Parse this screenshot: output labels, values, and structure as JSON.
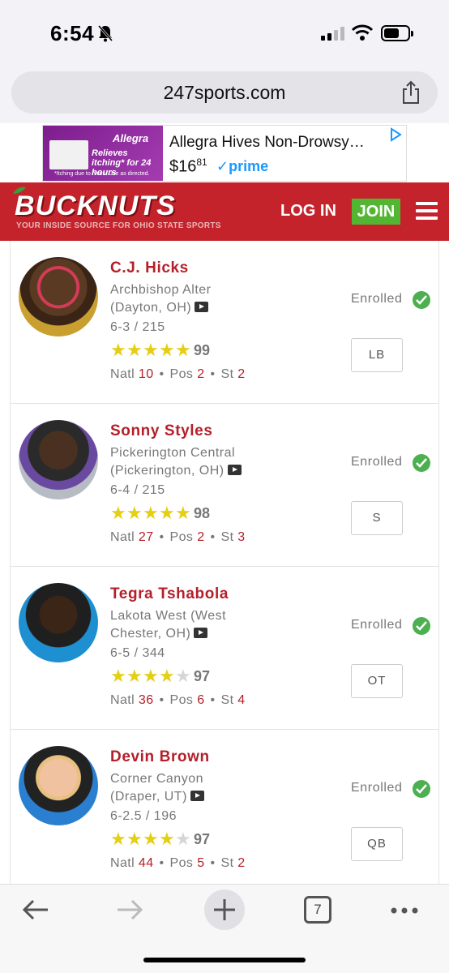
{
  "status_bar": {
    "time": "6:54"
  },
  "browser": {
    "url": "247sports.com"
  },
  "ad": {
    "brand": "Allegra",
    "claim": "Relieves itching* for 24 hours",
    "fine_print": "*Itching due to hives. Use as directed.",
    "title": "Allegra Hives Non-Drowsy…",
    "price_dollars": "$16",
    "price_cents": "81",
    "prime": "✓prime"
  },
  "site": {
    "logo": "BUCKNUTS",
    "tagline": "YOUR INSIDE SOURCE FOR OHIO STATE SPORTS",
    "login": "LOG IN",
    "join": "JOIN",
    "colors": {
      "header": "#c5232b",
      "join": "#53b632",
      "accent": "#b4202a"
    }
  },
  "players": [
    {
      "name": "C.J. Hicks",
      "school_line1": "Archbishop Alter",
      "school_line2": "(Dayton, OH)",
      "measurables": "6-3 / 215",
      "stars": 5,
      "rating": "99",
      "natl": "10",
      "pos_rank": "2",
      "st_rank": "2",
      "status": "Enrolled",
      "position": "LB"
    },
    {
      "name": "Sonny Styles",
      "school_line1": "Pickerington Central",
      "school_line2": "(Pickerington, OH)",
      "measurables": "6-4 / 215",
      "stars": 5,
      "rating": "98",
      "natl": "27",
      "pos_rank": "2",
      "st_rank": "3",
      "status": "Enrolled",
      "position": "S"
    },
    {
      "name": "Tegra Tshabola",
      "school_line1": "Lakota West (West",
      "school_line2": "Chester, OH)",
      "measurables": "6-5 / 344",
      "stars": 4,
      "rating": "97",
      "natl": "36",
      "pos_rank": "6",
      "st_rank": "4",
      "status": "Enrolled",
      "position": "OT"
    },
    {
      "name": "Devin Brown",
      "school_line1": "Corner Canyon",
      "school_line2": "(Draper, UT)",
      "measurables": "6-2.5 / 196",
      "stars": 4,
      "rating": "97",
      "natl": "44",
      "pos_rank": "5",
      "st_rank": "2",
      "status": "Enrolled",
      "position": "QB"
    }
  ],
  "labels": {
    "natl": "Natl",
    "pos": "Pos",
    "st": "St",
    "dot": "•"
  },
  "toolbar": {
    "tab_count": "7"
  }
}
